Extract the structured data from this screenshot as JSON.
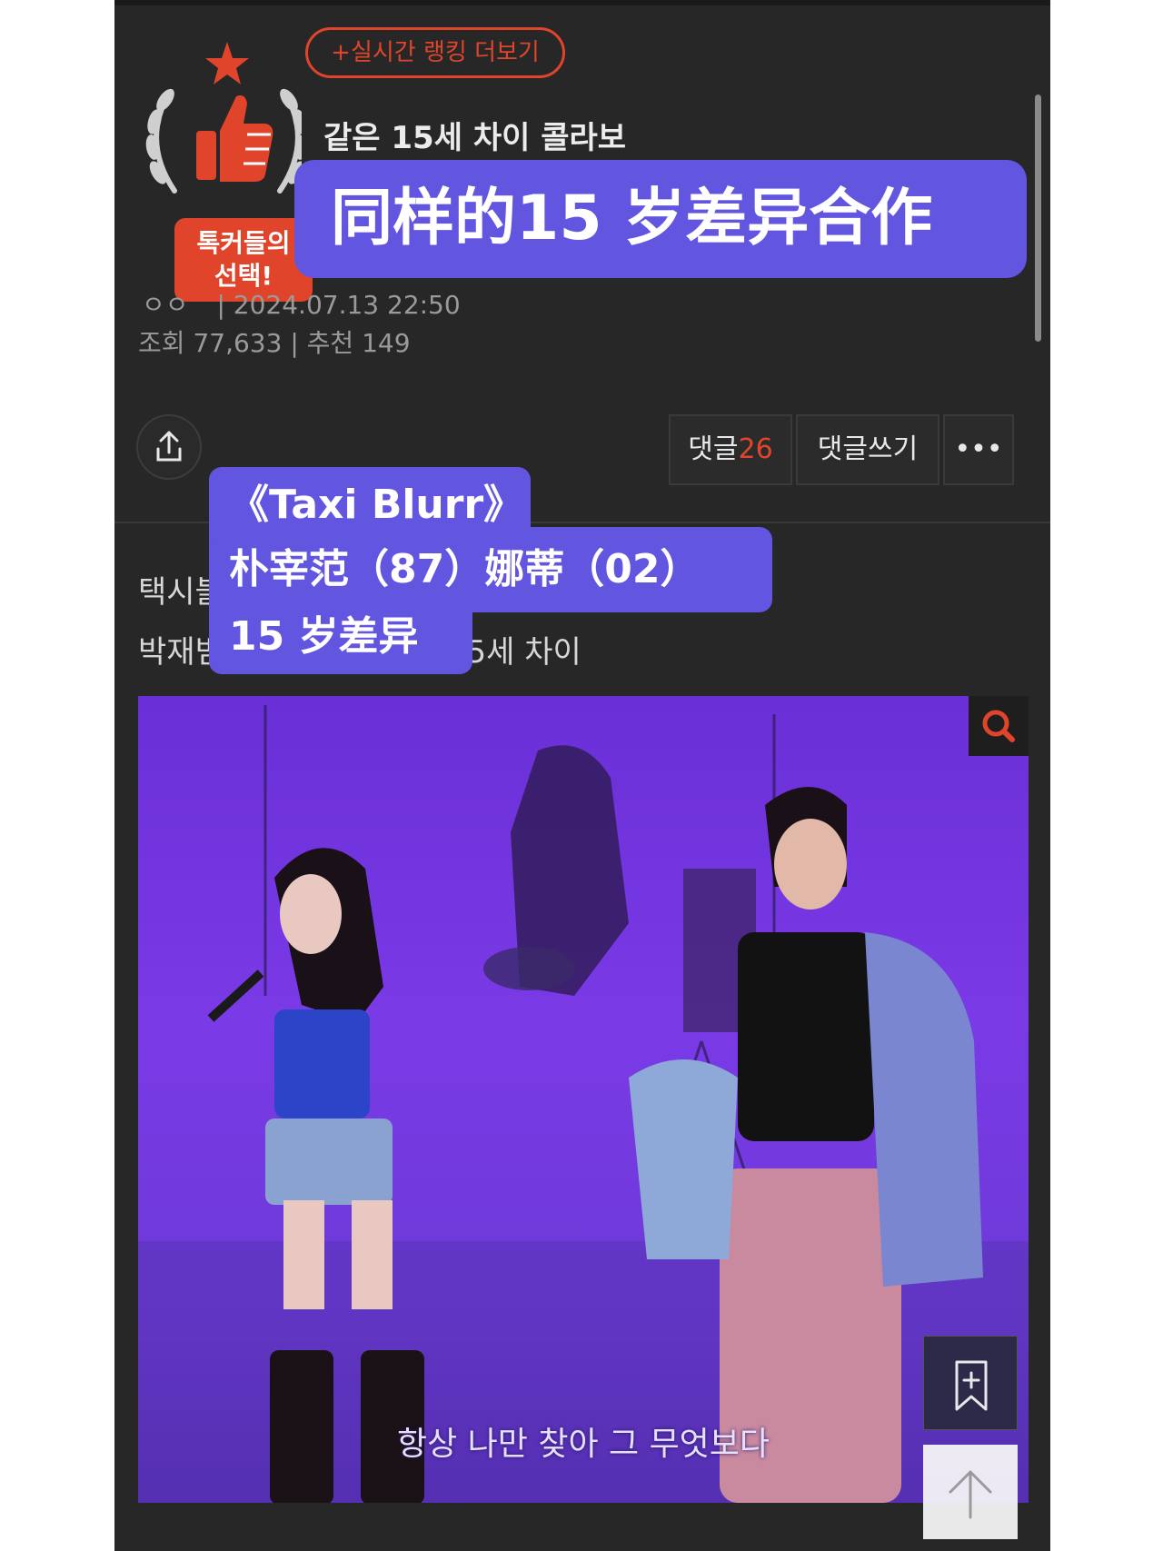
{
  "header": {
    "ranking_button": "+실시간 랭킹 더보기",
    "award_label_line1": "톡커들의",
    "award_label_line2": "선택!",
    "title": "같은 15세 차이 콜라보",
    "overlay_title": "同样的15 岁差异合作"
  },
  "meta": {
    "author": "ㅇㅇ",
    "separator": "|",
    "datetime": "2024.07.13 22:50",
    "views_label": "조회",
    "views": "77,633",
    "likes_label": "추천",
    "likes": "149"
  },
  "actions": {
    "comments_label": "댓글",
    "comments_count": "26",
    "write_comment": "댓글쓰기",
    "more": "•••"
  },
  "body": {
    "line1": "택시블러",
    "line2": "박재범(87) 나띠(02) : 15세 차이"
  },
  "caption_overlay": {
    "line1": "《Taxi Blurr》",
    "line2": "朴宰范（87）娜蒂（02）",
    "line3": "15 岁差异"
  },
  "photo": {
    "subtitle": "항상 나만 찾아 그 무엇보다",
    "background_color": "#6a2fd6"
  },
  "icons": [
    "share-icon",
    "search-icon",
    "bookmark-add-icon",
    "arrow-up-icon",
    "laurel-icon",
    "thumbs-up-icon",
    "star-icon"
  ],
  "colors": {
    "accent": "#e0452b",
    "overlay": "#6255e0",
    "background": "#272727"
  }
}
